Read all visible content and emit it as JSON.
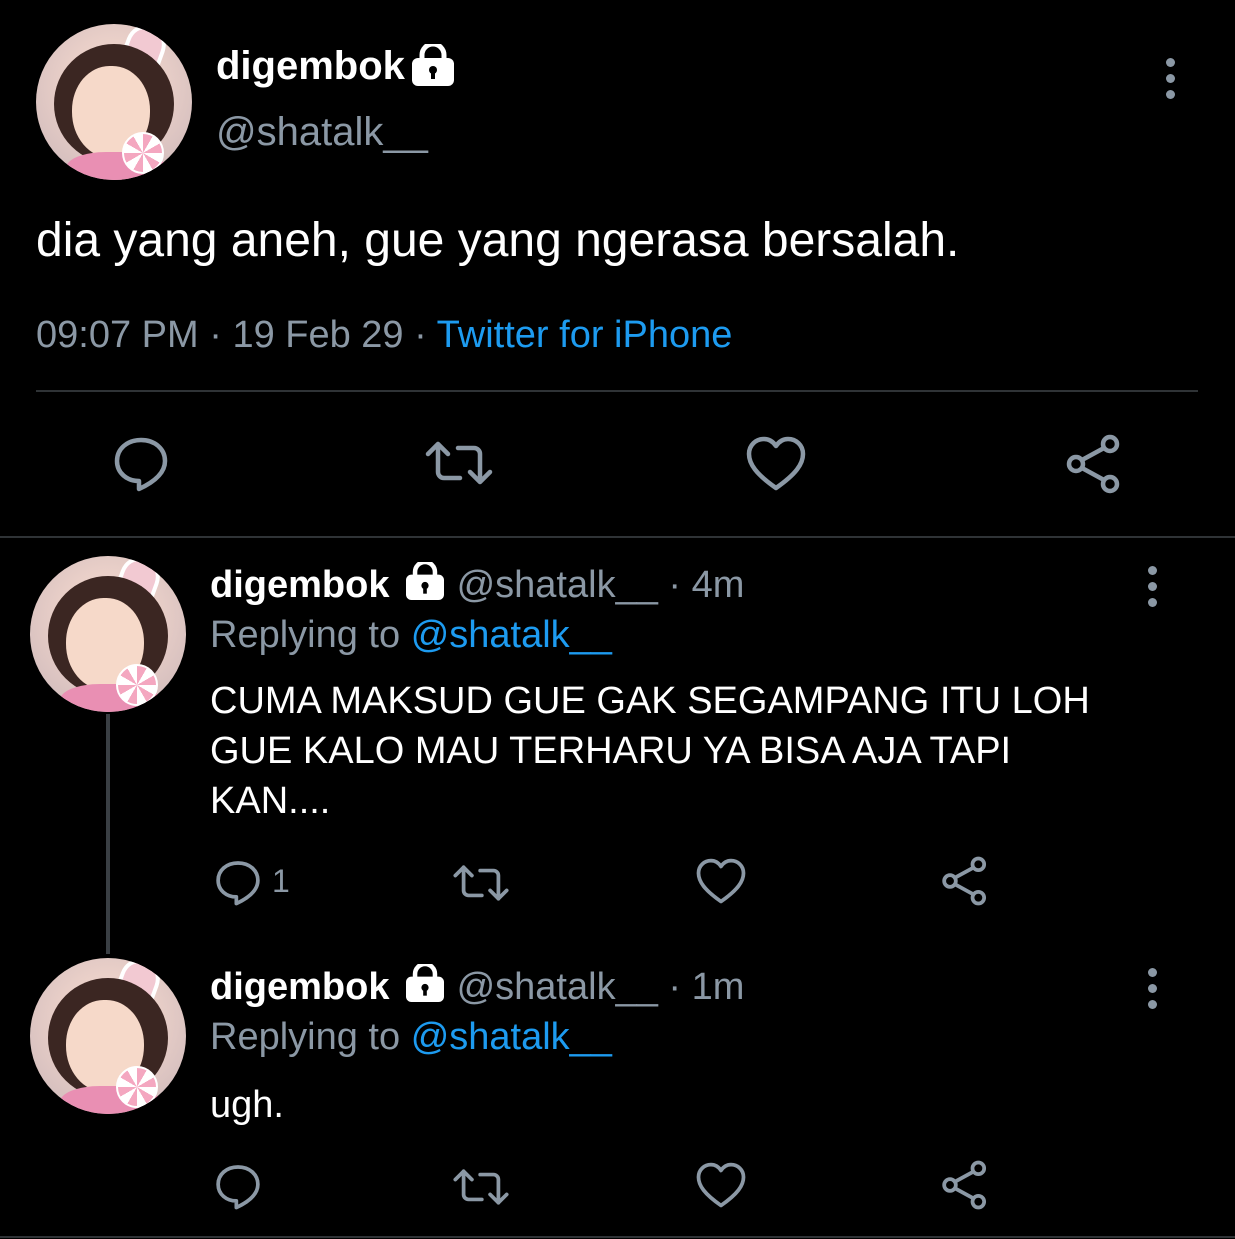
{
  "main_tweet": {
    "display_name": "digembok",
    "handle": "@shatalk__",
    "text": "dia yang aneh, gue yang ngerasa bersalah.",
    "time": "09:07 PM",
    "date": "19 Feb 29",
    "sep": "·",
    "source": "Twitter for iPhone"
  },
  "replies": [
    {
      "display_name": "digembok",
      "handle": "@shatalk__",
      "age": "· 4m",
      "replying_prefix": "Replying to",
      "replying_to": "@shatalk__",
      "text_lines": [
        "CUMA MAKSUD GUE GAK SEGAMPANG ITU LOH",
        "GUE KALO MAU TERHARU YA BISA AJA TAPI",
        "KAN...."
      ],
      "reply_count": "1"
    },
    {
      "display_name": "digembok",
      "handle": "@shatalk__",
      "age": "· 1m",
      "replying_prefix": "Replying to",
      "replying_to": "@shatalk__",
      "text_lines": [
        "ugh."
      ],
      "reply_count": ""
    }
  ],
  "icons": {
    "reply": "speech-bubble-icon",
    "retweet": "retweet-icon",
    "like": "heart-icon",
    "share": "share-icon",
    "more": "more-vertical-icon",
    "lock": "lock-icon"
  },
  "colors": {
    "background": "#000000",
    "muted": "#8b98a5",
    "link": "#1d9bf0"
  }
}
